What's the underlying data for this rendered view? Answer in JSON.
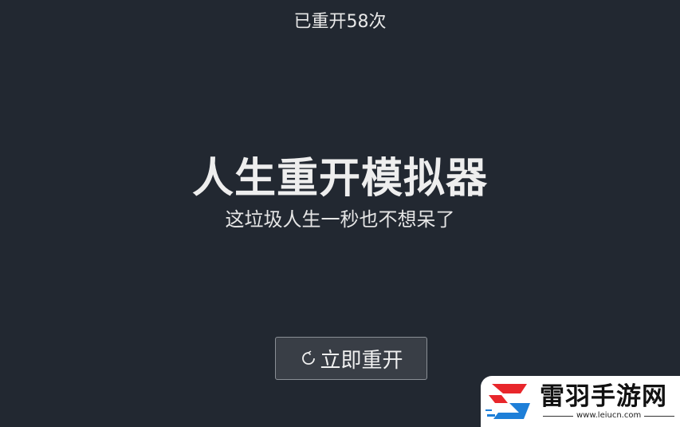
{
  "header": {
    "restart_count_text": "已重开58次"
  },
  "main": {
    "title": "人生重开模拟器",
    "subtitle": "这垃圾人生一秒也不想呆了",
    "restart_button_label": "立即重开",
    "restart_icon": "refresh-icon"
  },
  "watermark": {
    "name": "雷羽手游网",
    "url": "www.leiucn.com",
    "colors": {
      "red": "#e8262b",
      "blue": "#1e7fd8"
    }
  },
  "colors": {
    "background": "#222831",
    "button_bg": "#393e46",
    "button_border": "#8a8f96",
    "text": "#eeeeee"
  }
}
